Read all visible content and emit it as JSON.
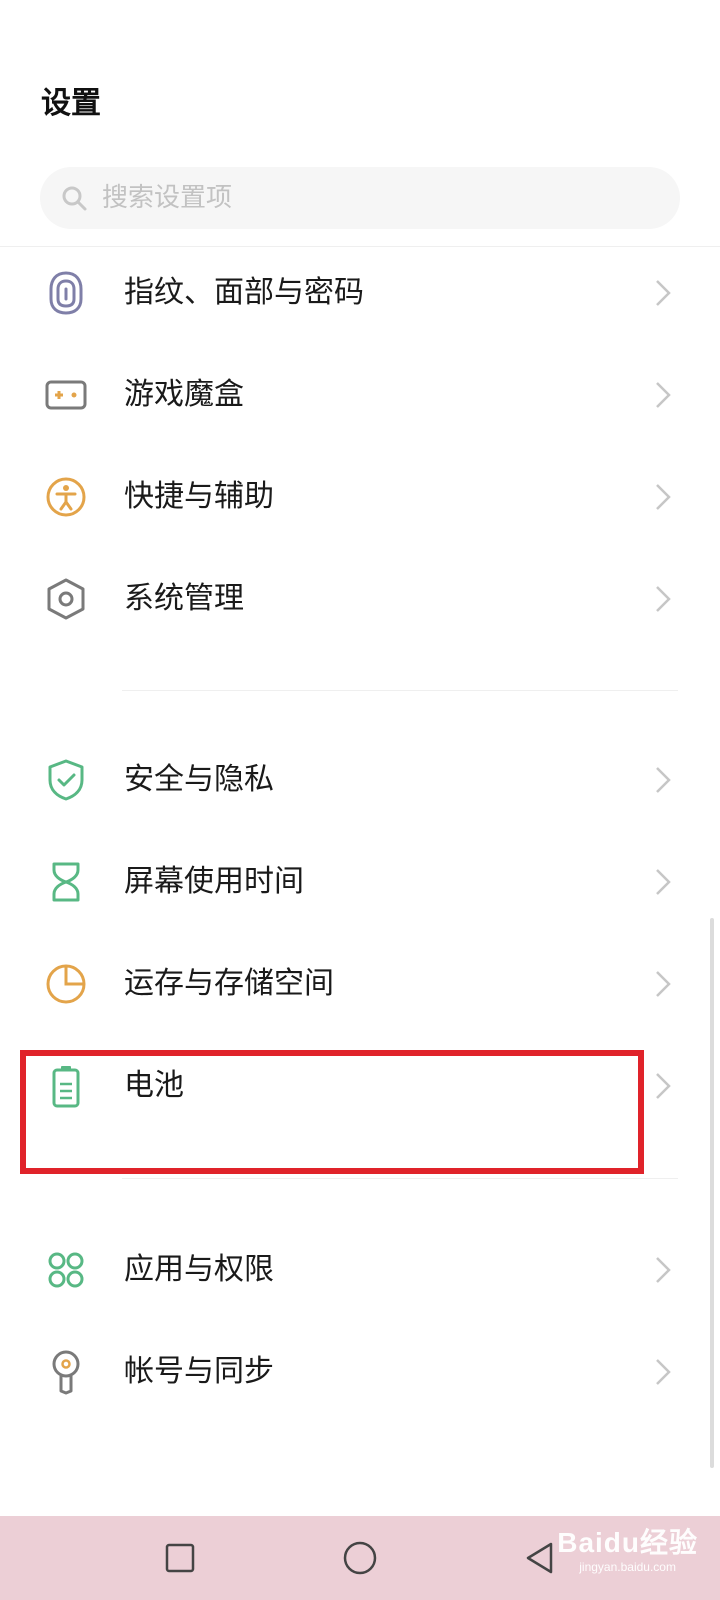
{
  "header": {
    "title": "设置"
  },
  "search": {
    "placeholder": "搜索设置项",
    "value": "",
    "icon": "search-icon"
  },
  "colors": {
    "highlight_border": "#e0232a",
    "navbar_bg": "#eccfd6",
    "icon_purple": "#7f7fa8",
    "icon_orange": "#e3a44a",
    "icon_gray": "#7a7a7a",
    "icon_green": "#58b884"
  },
  "groups": [
    {
      "items": [
        {
          "label": "指纹、面部与密码",
          "icon": "fingerprint-icon"
        },
        {
          "label": "游戏魔盒",
          "icon": "gamepad-icon"
        },
        {
          "label": "快捷与辅助",
          "icon": "accessibility-icon"
        },
        {
          "label": "系统管理",
          "icon": "hexagon-settings-icon"
        }
      ]
    },
    {
      "items": [
        {
          "label": "安全与隐私",
          "icon": "shield-check-icon"
        },
        {
          "label": "屏幕使用时间",
          "icon": "hourglass-icon"
        },
        {
          "label": "运存与存储空间",
          "icon": "pie-chart-icon"
        },
        {
          "label": "电池",
          "icon": "battery-icon",
          "highlighted": true
        }
      ]
    },
    {
      "items": [
        {
          "label": "应用与权限",
          "icon": "apps-grid-icon"
        },
        {
          "label": "帐号与同步",
          "icon": "account-key-icon"
        }
      ]
    }
  ],
  "navbar": {
    "recent": "square-icon",
    "home": "circle-icon",
    "back": "back-triangle-icon"
  },
  "watermark": {
    "main": "Baidu经验",
    "sub": "jingyan.baidu.com"
  }
}
